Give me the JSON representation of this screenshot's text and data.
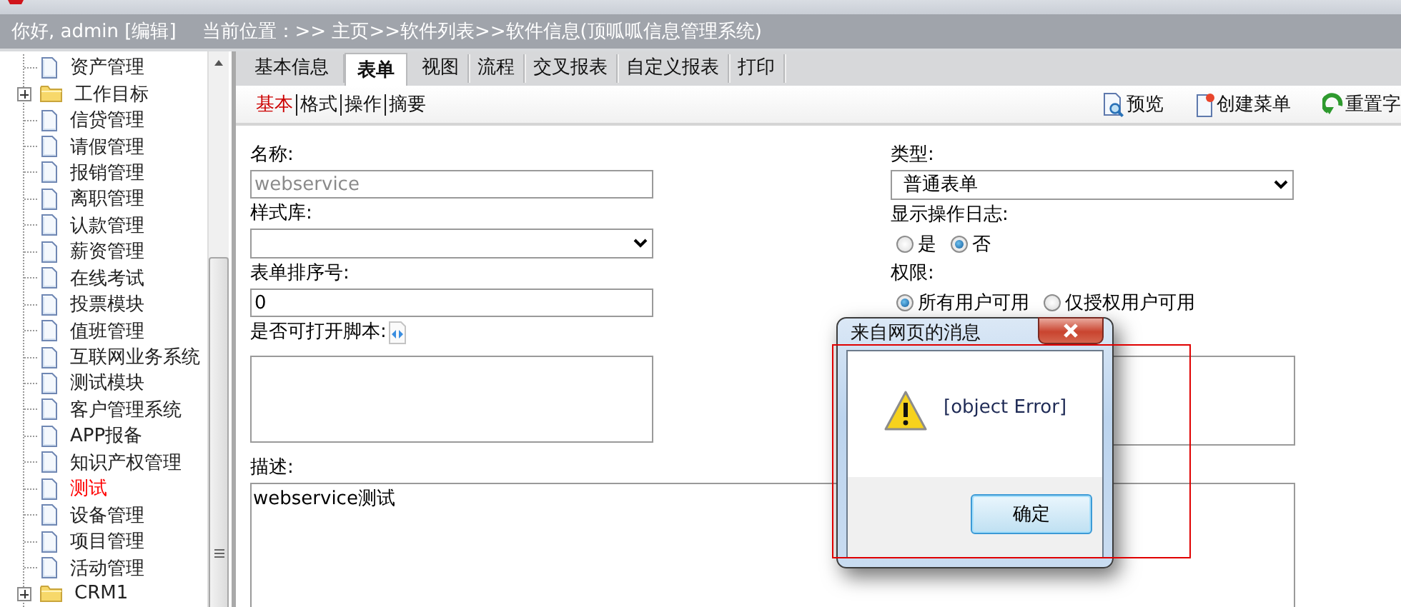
{
  "header": {
    "greeting": "你好, admin [编辑]",
    "breadcrumb": "当前位置：>> 主页>>软件列表>>软件信息(顶呱呱信息管理系统)"
  },
  "sidebar": {
    "items": [
      {
        "label": "资产管理",
        "kind": "page",
        "selected": false
      },
      {
        "label": "工作目标",
        "kind": "folder",
        "selected": false,
        "expanded": false
      },
      {
        "label": "信贷管理",
        "kind": "page",
        "selected": false
      },
      {
        "label": "请假管理",
        "kind": "page",
        "selected": false
      },
      {
        "label": "报销管理",
        "kind": "page",
        "selected": false
      },
      {
        "label": "离职管理",
        "kind": "page",
        "selected": false
      },
      {
        "label": "认款管理",
        "kind": "page",
        "selected": false
      },
      {
        "label": "薪资管理",
        "kind": "page",
        "selected": false
      },
      {
        "label": "在线考试",
        "kind": "page",
        "selected": false
      },
      {
        "label": "投票模块",
        "kind": "page",
        "selected": false
      },
      {
        "label": "值班管理",
        "kind": "page",
        "selected": false
      },
      {
        "label": "互联网业务系统",
        "kind": "page",
        "selected": false
      },
      {
        "label": "测试模块",
        "kind": "page",
        "selected": false
      },
      {
        "label": "客户管理系统",
        "kind": "page",
        "selected": false
      },
      {
        "label": "APP报备",
        "kind": "page",
        "selected": false
      },
      {
        "label": "知识产权管理",
        "kind": "page",
        "selected": false
      },
      {
        "label": "测试",
        "kind": "page",
        "selected": true
      },
      {
        "label": "设备管理",
        "kind": "page",
        "selected": false
      },
      {
        "label": "项目管理",
        "kind": "page",
        "selected": false
      },
      {
        "label": "活动管理",
        "kind": "page",
        "selected": false
      },
      {
        "label": "CRM1",
        "kind": "folder",
        "selected": false,
        "expanded": false
      }
    ]
  },
  "tabs": [
    {
      "label": "基本信息",
      "selected": false
    },
    {
      "label": "表单",
      "selected": true
    },
    {
      "label": "视图",
      "selected": false
    },
    {
      "label": "流程",
      "selected": false
    },
    {
      "label": "交叉报表",
      "selected": false
    },
    {
      "label": "自定义报表",
      "selected": false
    },
    {
      "label": "打印",
      "selected": false
    }
  ],
  "subtabs": [
    {
      "label": "基本",
      "selected": true
    },
    {
      "label": "格式",
      "selected": false
    },
    {
      "label": "操作",
      "selected": false
    },
    {
      "label": "摘要",
      "selected": false
    }
  ],
  "toolbar": [
    {
      "label": "预览",
      "kind": "preview"
    },
    {
      "label": "创建菜单",
      "kind": "create"
    },
    {
      "label": "重置字",
      "kind": "reset"
    }
  ],
  "form": {
    "name": {
      "label": "名称:",
      "value": "webservice",
      "disabled": true
    },
    "style_library": {
      "label": "样式库:"
    },
    "order": {
      "label": "表单排序号:",
      "value": "0"
    },
    "script": {
      "label": "是否可打开脚本:"
    },
    "type": {
      "label": "类型:",
      "value": "普通表单"
    },
    "log": {
      "label": "显示操作日志:",
      "options": [
        {
          "label": "是",
          "selected": false
        },
        {
          "label": "否",
          "selected": true
        }
      ]
    },
    "permission": {
      "label": "权限:",
      "options": [
        {
          "label": "所有用户可用",
          "selected": true
        },
        {
          "label": "仅授权用户可用",
          "selected": false
        }
      ]
    },
    "description": {
      "label": "描述:",
      "value": "webservice测试"
    }
  },
  "dialog": {
    "title": "来自网页的消息",
    "message": "[object Error]",
    "button": "确定"
  }
}
